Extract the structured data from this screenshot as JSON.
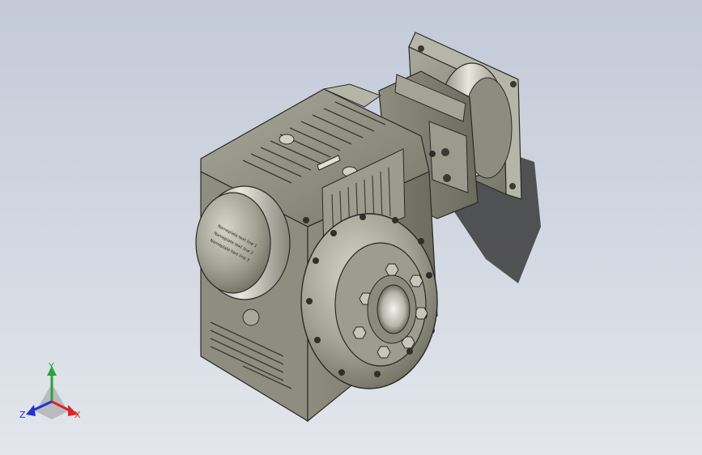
{
  "viewport": {
    "background_top": "#c3cad8",
    "background_bottom": "#e3e6ec"
  },
  "model": {
    "body_color": "#8d8d7f",
    "nameplate_lines": [
      "Nameplate text line 1",
      "Nameplate text line 2",
      "Nameplate text line 3"
    ]
  },
  "triad": {
    "x_label": "X",
    "y_label": "Y",
    "z_label": "Z",
    "x_color": "#d8262b",
    "y_color": "#2aa33a",
    "z_color": "#2233cc"
  }
}
